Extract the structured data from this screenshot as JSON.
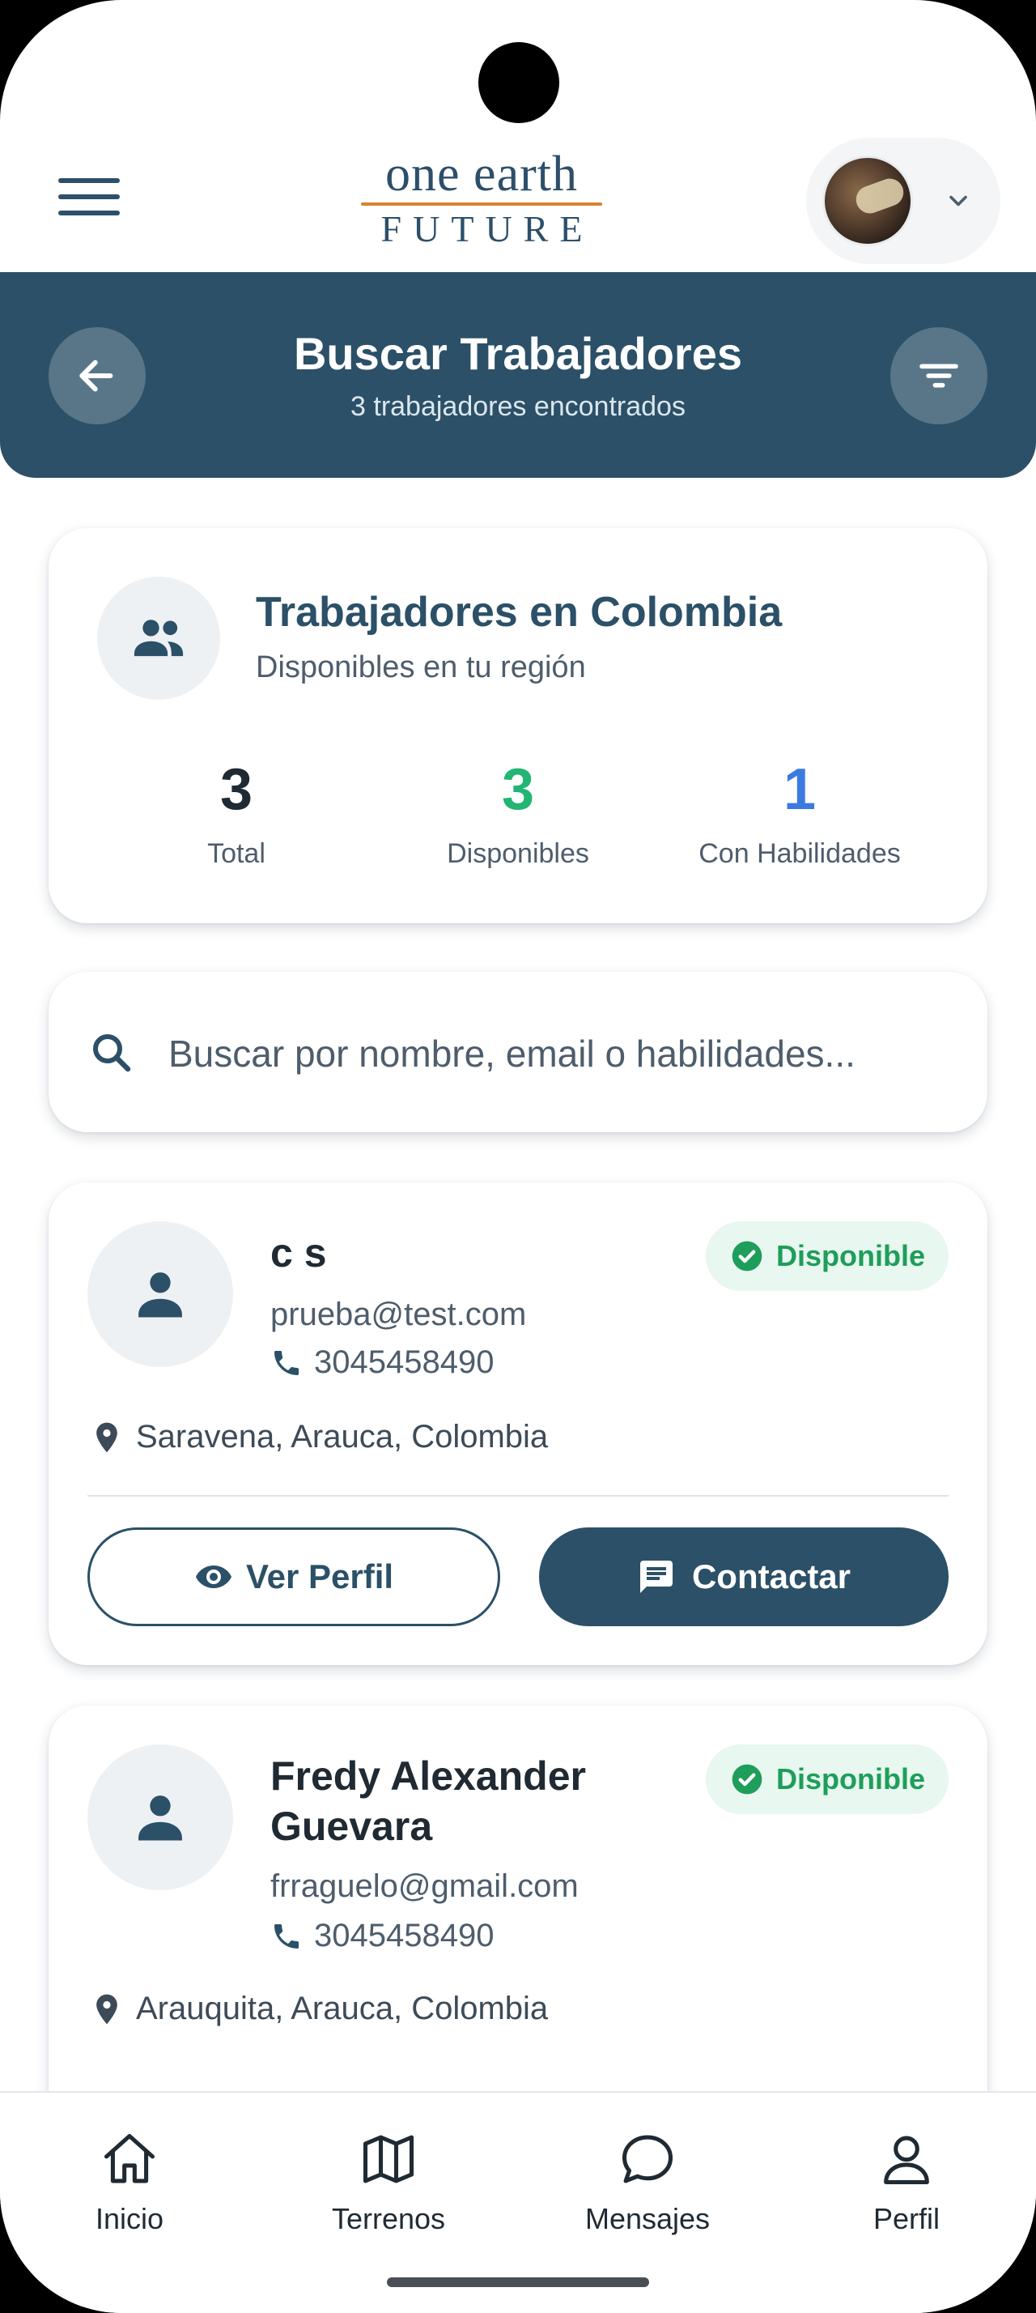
{
  "header": {
    "logo_top": "one earth",
    "logo_bottom": "FUTURE"
  },
  "title_bar": {
    "title": "Buscar Trabajadores",
    "subtitle": "3 trabajadores encontrados"
  },
  "stats": {
    "title": "Trabajadores en Colombia",
    "subtitle": "Disponibles en tu región",
    "items": [
      {
        "value": "3",
        "label": "Total",
        "color": "#1f2a33"
      },
      {
        "value": "3",
        "label": "Disponibles",
        "color": "#22b573"
      },
      {
        "value": "1",
        "label": "Con Habilidades",
        "color": "#3b7be0"
      }
    ]
  },
  "search": {
    "placeholder": "Buscar por nombre, email o habilidades..."
  },
  "workers": [
    {
      "name": "c s",
      "status": "Disponible",
      "email": "prueba@test.com",
      "phone": "3045458490",
      "location": "Saravena, Arauca, Colombia",
      "view_label": "Ver Perfil",
      "contact_label": "Contactar"
    },
    {
      "name": "Fredy Alexander Guevara",
      "status": "Disponible",
      "email": "frraguelo@gmail.com",
      "phone": "3045458490",
      "location": "Arauquita, Arauca, Colombia"
    }
  ],
  "bottom_nav": [
    {
      "label": "Inicio",
      "icon": "home-icon"
    },
    {
      "label": "Terrenos",
      "icon": "map-icon"
    },
    {
      "label": "Mensajes",
      "icon": "message-icon"
    },
    {
      "label": "Perfil",
      "icon": "user-icon"
    }
  ],
  "colors": {
    "primary": "#2b5068",
    "available_green": "#1e9e5a",
    "accent_blue": "#3b7be0",
    "logo_orange": "#d5852f"
  }
}
